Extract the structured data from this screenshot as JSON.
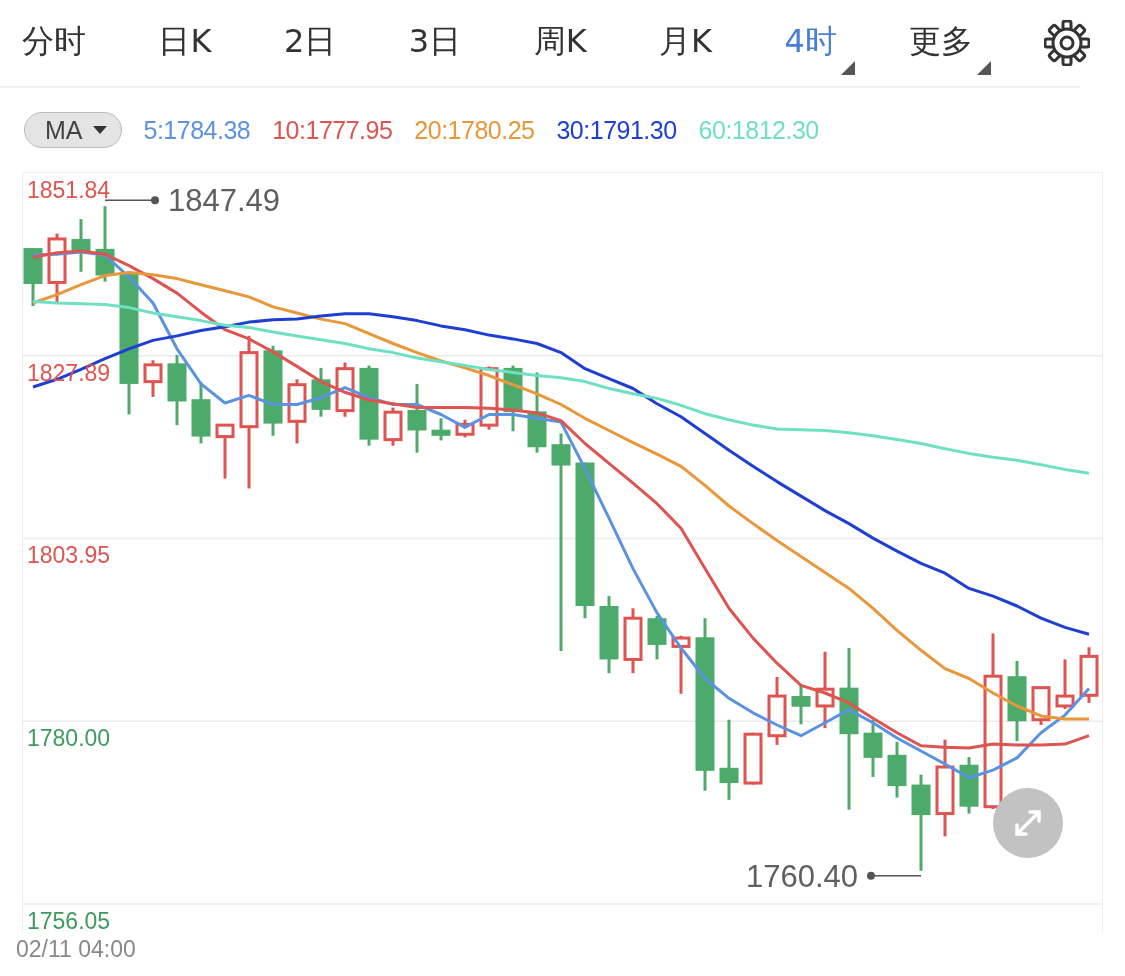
{
  "tabs": [
    {
      "label": "分时",
      "selected": false,
      "dropdown": false
    },
    {
      "label": "日K",
      "selected": false,
      "dropdown": false
    },
    {
      "label": "2日",
      "selected": false,
      "dropdown": false
    },
    {
      "label": "3日",
      "selected": false,
      "dropdown": false
    },
    {
      "label": "周K",
      "selected": false,
      "dropdown": false
    },
    {
      "label": "月K",
      "selected": false,
      "dropdown": false
    },
    {
      "label": "4时",
      "selected": true,
      "dropdown": true
    },
    {
      "label": "更多",
      "selected": false,
      "dropdown": true
    }
  ],
  "indicator": {
    "label": "MA"
  },
  "legend": [
    {
      "label": "5:1784.38",
      "color": "#5b93e0"
    },
    {
      "label": "10:1777.95",
      "color": "#dd5450"
    },
    {
      "label": "20:1780.25",
      "color": "#e8973a"
    },
    {
      "label": "30:1791.30",
      "color": "#1e3fd1"
    },
    {
      "label": "60:1812.30",
      "color": "#6fe0c2"
    }
  ],
  "chart": {
    "chart_data": {
      "type": "line",
      "grid": true,
      "ylim": [
        1756.05,
        1851.84
      ],
      "yticks": [
        {
          "value": 1851.84,
          "label": "1851.84"
        },
        {
          "value": 1827.89,
          "label": "1827.89"
        },
        {
          "value": 1803.95,
          "label": "1803.95"
        },
        {
          "value": 1780.0,
          "label": "1780.00"
        },
        {
          "value": 1756.05,
          "label": "1756.05"
        }
      ],
      "series": [
        {
          "type": "candlestick",
          "ohlc": [
            [
              1842.0,
              1842.0,
              1834.4,
              1837.3
            ],
            [
              1837.5,
              1843.9,
              1834.7,
              1843.2
            ],
            [
              1843.2,
              1845.8,
              1838.9,
              1841.4
            ],
            [
              1841.9,
              1847.49,
              1837.6,
              1838.4
            ],
            [
              1838.8,
              1839.0,
              1820.2,
              1824.2
            ],
            [
              1824.5,
              1827.3,
              1822.5,
              1826.7
            ],
            [
              1826.9,
              1828.0,
              1818.8,
              1821.9
            ],
            [
              1822.2,
              1824.4,
              1816.4,
              1817.3
            ],
            [
              1817.3,
              1818.8,
              1811.8,
              1818.8
            ],
            [
              1818.6,
              1830.5,
              1810.5,
              1828.3
            ],
            [
              1828.6,
              1829.2,
              1817.4,
              1819.0
            ],
            [
              1819.3,
              1824.8,
              1816.4,
              1824.1
            ],
            [
              1824.8,
              1826.3,
              1819.9,
              1820.8
            ],
            [
              1820.7,
              1827.0,
              1819.9,
              1826.2
            ],
            [
              1826.3,
              1826.6,
              1816.1,
              1816.9
            ],
            [
              1816.9,
              1821.1,
              1816.1,
              1820.5
            ],
            [
              1820.8,
              1824.2,
              1815.2,
              1818.1
            ],
            [
              1818.2,
              1819.7,
              1816.8,
              1817.4
            ],
            [
              1817.6,
              1819.5,
              1817.2,
              1818.9
            ],
            [
              1818.8,
              1826.5,
              1818.2,
              1826.2
            ],
            [
              1826.3,
              1826.6,
              1818.0,
              1820.5
            ],
            [
              1820.6,
              1825.7,
              1815.2,
              1815.9
            ],
            [
              1816.3,
              1817.7,
              1789.2,
              1813.5
            ],
            [
              1813.9,
              1813.9,
              1793.5,
              1795.1
            ],
            [
              1795.1,
              1796.4,
              1786.3,
              1788.1
            ],
            [
              1788.1,
              1794.8,
              1786.3,
              1793.5
            ],
            [
              1793.5,
              1793.8,
              1788.1,
              1790.0
            ],
            [
              1789.8,
              1791.2,
              1783.6,
              1790.9
            ],
            [
              1791.0,
              1793.5,
              1770.9,
              1773.5
            ],
            [
              1773.9,
              1780.2,
              1769.7,
              1771.9
            ],
            [
              1771.9,
              1778.5,
              1771.7,
              1778.3
            ],
            [
              1778.1,
              1785.8,
              1776.9,
              1783.3
            ],
            [
              1783.3,
              1784.7,
              1779.6,
              1781.9
            ],
            [
              1782.0,
              1789.1,
              1779.1,
              1784.2
            ],
            [
              1784.4,
              1789.6,
              1768.4,
              1778.3
            ],
            [
              1778.5,
              1780.2,
              1772.7,
              1775.2
            ],
            [
              1775.6,
              1777.3,
              1770.0,
              1771.5
            ],
            [
              1771.7,
              1773.0,
              1760.4,
              1767.7
            ],
            [
              1767.9,
              1777.6,
              1764.9,
              1774.0
            ],
            [
              1774.3,
              1775.3,
              1767.9,
              1768.8
            ],
            [
              1768.8,
              1791.5,
              1768.5,
              1785.9
            ],
            [
              1785.9,
              1787.9,
              1777.4,
              1780.0
            ],
            [
              1780.2,
              1784.4,
              1779.5,
              1784.4
            ],
            [
              1782.0,
              1788.1,
              1781.6,
              1783.3
            ],
            [
              1783.4,
              1789.7,
              1782.4,
              1788.5
            ]
          ]
        },
        {
          "color": "#5b93e0",
          "values": [
            1841.1,
            1841.2,
            1841.5,
            1841.1,
            1838.2,
            1834.8,
            1828.8,
            1824.2,
            1821.7,
            1822.7,
            1821.5,
            1821.5,
            1822.4,
            1823.7,
            1822.4,
            1821.5,
            1821.5,
            1820.2,
            1818.5,
            1820.2,
            1820.2,
            1819.7,
            1819.2,
            1813.1,
            1806.6,
            1800.0,
            1794.2,
            1789.6,
            1785.6,
            1783.0,
            1781.1,
            1779.5,
            1778.1,
            1779.8,
            1781.5,
            1779.8,
            1777.8,
            1776.1,
            1774.4,
            1772.6,
            1773.6,
            1775.2,
            1778.5,
            1780.8,
            1784.3
          ]
        },
        {
          "color": "#dd5450",
          "values": [
            1840.8,
            1841.4,
            1841.6,
            1841.2,
            1839.7,
            1838.0,
            1836.1,
            1833.6,
            1831.3,
            1830.1,
            1828.4,
            1826.5,
            1824.5,
            1823.1,
            1822.1,
            1821.6,
            1821.1,
            1821.1,
            1821.1,
            1821.0,
            1820.8,
            1820.4,
            1819.4,
            1816.4,
            1813.8,
            1811.2,
            1808.5,
            1805.3,
            1800.0,
            1794.8,
            1790.9,
            1787.6,
            1784.7,
            1783.7,
            1782.4,
            1780.4,
            1778.5,
            1776.8,
            1776.6,
            1776.5,
            1777.0,
            1776.9,
            1776.9,
            1777.0,
            1778.1
          ]
        },
        {
          "color": "#e8973a",
          "values": [
            1834.8,
            1835.9,
            1837.2,
            1838.4,
            1838.8,
            1838.5,
            1838.0,
            1837.2,
            1836.4,
            1835.6,
            1834.3,
            1833.5,
            1832.7,
            1832.1,
            1830.8,
            1829.5,
            1828.3,
            1827.2,
            1826.3,
            1825.3,
            1824.1,
            1822.9,
            1821.5,
            1819.7,
            1818.1,
            1816.5,
            1815.0,
            1813.4,
            1810.9,
            1808.2,
            1805.9,
            1803.7,
            1801.6,
            1799.5,
            1797.4,
            1794.8,
            1791.9,
            1789.3,
            1786.9,
            1785.6,
            1783.7,
            1782.0,
            1780.7,
            1780.3,
            1780.3
          ]
        },
        {
          "color": "#1e3fd1",
          "values": [
            1823.8,
            1824.8,
            1826.1,
            1827.5,
            1828.8,
            1829.9,
            1830.5,
            1831.2,
            1831.7,
            1832.3,
            1832.6,
            1832.7,
            1833.1,
            1833.4,
            1833.4,
            1833.0,
            1832.5,
            1831.8,
            1831.3,
            1830.6,
            1830.1,
            1829.5,
            1828.3,
            1826.2,
            1824.9,
            1823.6,
            1821.6,
            1819.9,
            1817.7,
            1815.5,
            1813.4,
            1811.4,
            1809.5,
            1807.6,
            1805.9,
            1804.0,
            1802.3,
            1800.7,
            1799.4,
            1797.4,
            1796.4,
            1795.1,
            1793.5,
            1792.3,
            1791.4
          ]
        },
        {
          "color": "#6fe0c2",
          "values": [
            1835.0,
            1834.8,
            1834.7,
            1834.6,
            1834.2,
            1833.5,
            1833.0,
            1832.5,
            1831.9,
            1831.6,
            1831.0,
            1830.5,
            1830.0,
            1829.5,
            1828.8,
            1828.3,
            1827.6,
            1827.1,
            1826.6,
            1826.1,
            1825.7,
            1825.3,
            1825.0,
            1824.5,
            1823.6,
            1822.9,
            1822.3,
            1821.4,
            1820.3,
            1819.5,
            1818.8,
            1818.3,
            1818.2,
            1818.1,
            1817.8,
            1817.4,
            1816.9,
            1816.4,
            1815.7,
            1815.1,
            1814.6,
            1814.2,
            1813.6,
            1813.0,
            1812.5
          ]
        }
      ],
      "annotations": [
        {
          "text": "1847.49"
        },
        {
          "text": "1760.40"
        }
      ]
    }
  },
  "time_label": "02/11 04:00"
}
